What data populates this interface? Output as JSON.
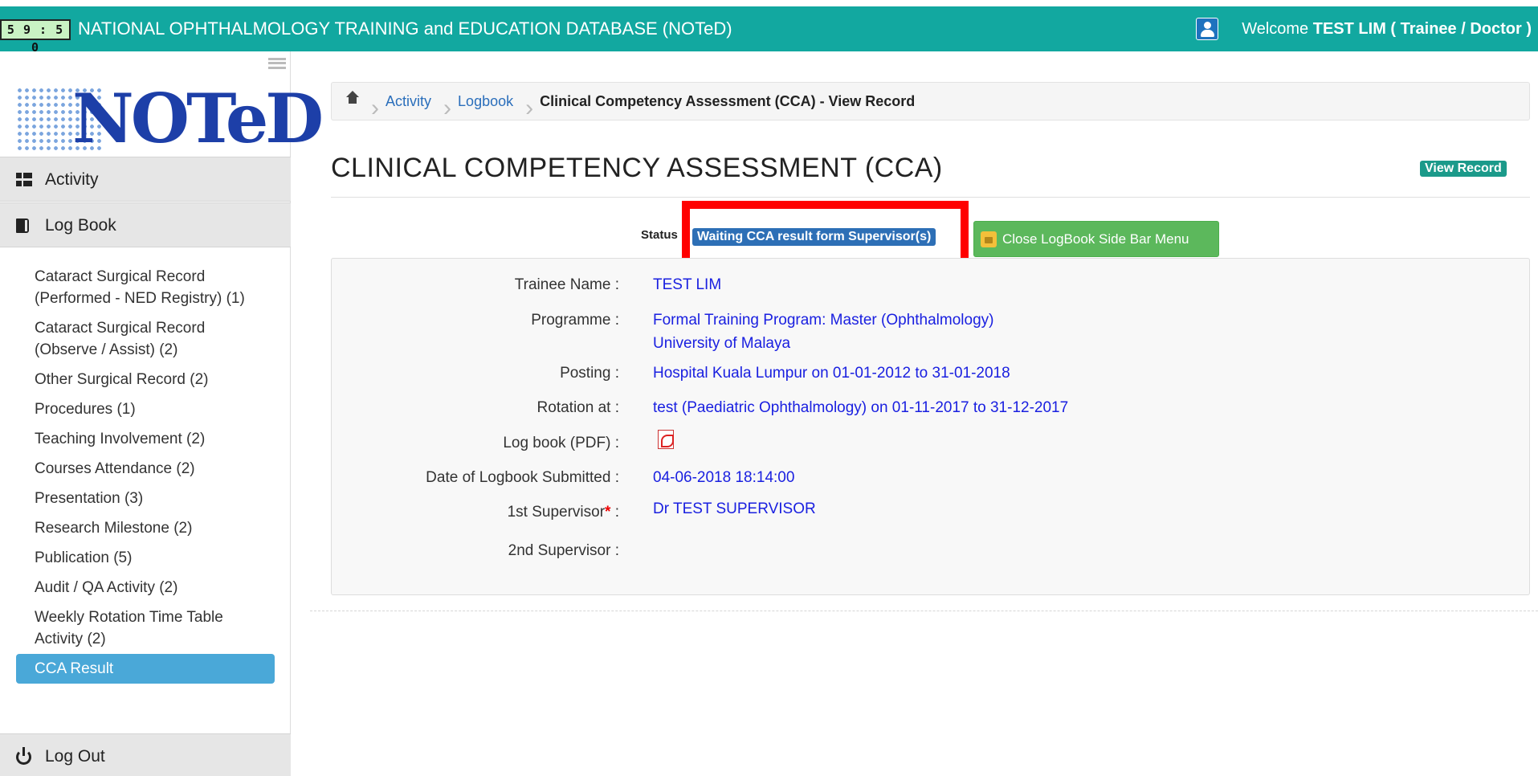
{
  "topbar": {
    "timer": "5 9 : 5 0",
    "title": "NATIONAL OPHTHALMOLOGY TRAINING and EDUCATION DATABASE (NOTeD)",
    "welcome_prefix": "Welcome",
    "user_name": "TEST LIM ( Trainee / Doctor )",
    "background_color": "#12a8a0"
  },
  "logo": {
    "text": "NOTeD"
  },
  "sidebar": {
    "sections": [
      {
        "label": "Activity",
        "icon": "th-large-icon"
      },
      {
        "label": "Log Book",
        "icon": "book-icon"
      },
      {
        "label": "Log Out",
        "icon": "power-icon"
      }
    ],
    "items": [
      {
        "label": "Cataract Surgical Record (Performed - NED Registry) (1)"
      },
      {
        "label": "Cataract Surgical Record (Observe / Assist) (2)"
      },
      {
        "label": "Other Surgical Record (2)"
      },
      {
        "label": "Procedures (1)"
      },
      {
        "label": "Teaching Involvement (2)"
      },
      {
        "label": "Courses Attendance (2)"
      },
      {
        "label": "Presentation (3)"
      },
      {
        "label": "Research Milestone (2)"
      },
      {
        "label": "Publication (5)"
      },
      {
        "label": "Audit / QA Activity (2)"
      },
      {
        "label": "Weekly Rotation Time Table Activity (2)"
      },
      {
        "label": "CCA Result",
        "active": true
      }
    ]
  },
  "breadcrumb": {
    "items": [
      "Activity",
      "Logbook"
    ],
    "current": "Clinical Competency Assessment (CCA) - View Record"
  },
  "page": {
    "title": "CLINICAL COMPETENCY ASSESSMENT (CCA)",
    "view_badge": "View Record",
    "status_label": "Status",
    "status_value": "Waiting CCA result form Supervisor(s)",
    "close_button": "Close LogBook Side Bar Menu"
  },
  "record": {
    "trainee_name_label": "Trainee Name :",
    "trainee_name": "TEST LIM",
    "programme_label": "Programme :",
    "programme_line1": "Formal Training Program: Master (Ophthalmology)",
    "programme_line2": "University of Malaya",
    "posting_label": "Posting :",
    "posting": "Hospital Kuala Lumpur on 01-01-2012 to 31-01-2018",
    "rotation_label": "Rotation at :",
    "rotation": "test (Paediatric Ophthalmology) on 01-11-2017 to 31-12-2017",
    "logbook_label": "Log book (PDF) :",
    "date_label": "Date of Logbook Submitted :",
    "date_submitted": "04-06-2018 18:14:00",
    "sup1_label": "1st Supervisor",
    "sup1_req": "*",
    "sup1_colon": " :",
    "sup1": "Dr TEST SUPERVISOR",
    "sup2_label": "2nd Supervisor :",
    "sup2": ""
  }
}
